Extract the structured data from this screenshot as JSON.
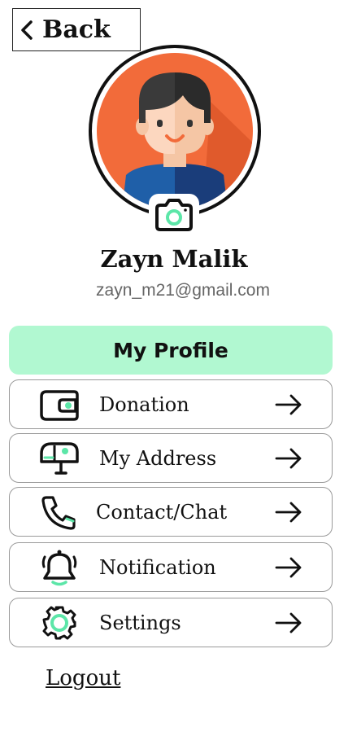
{
  "header": {
    "back_label": "Back"
  },
  "profile": {
    "name": "Zayn Malik",
    "email": "zayn_m21@gmail.com"
  },
  "section": {
    "title": "My Profile"
  },
  "menu": [
    {
      "label": "Donation",
      "icon": "wallet-icon"
    },
    {
      "label": "My Address",
      "icon": "mailbox-icon"
    },
    {
      "label": "Contact/Chat",
      "icon": "phone-icon"
    },
    {
      "label": "Notification",
      "icon": "bell-icon"
    },
    {
      "label": "Settings",
      "icon": "gear-icon"
    }
  ],
  "logout_label": "Logout",
  "colors": {
    "accent": "#b1f8d1",
    "icon_accent": "#5ce6a8",
    "avatar_bg": "#f26b3a",
    "shirt": "#1f5fa8"
  }
}
